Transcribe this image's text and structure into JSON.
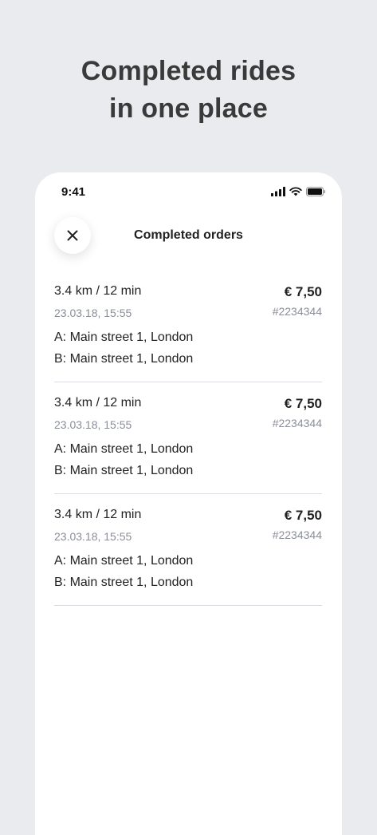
{
  "headline": {
    "line1": "Completed rides",
    "line2": "in one place"
  },
  "status_bar": {
    "time": "9:41",
    "icons": [
      "signal-icon",
      "wifi-icon",
      "battery-icon"
    ]
  },
  "header": {
    "close_icon": "close-icon",
    "title": "Completed orders"
  },
  "orders": [
    {
      "distance_time": "3.4 km / 12 min",
      "price": "€ 7,50",
      "date": "23.03.18, 15:55",
      "id": "#2234344",
      "from": "A: Main street 1, London",
      "to": "B: Main street 1, London"
    },
    {
      "distance_time": "3.4 km / 12 min",
      "price": "€ 7,50",
      "date": "23.03.18, 15:55",
      "id": "#2234344",
      "from": "A: Main street 1, London",
      "to": "B: Main street 1, London"
    },
    {
      "distance_time": "3.4 km / 12 min",
      "price": "€ 7,50",
      "date": "23.03.18, 15:55",
      "id": "#2234344",
      "from": "A: Main street 1, London",
      "to": "B: Main street 1, London"
    }
  ],
  "colors": {
    "background": "#e9ebee",
    "card": "#ffffff",
    "text": "#222222",
    "muted": "#8a8e98",
    "divider": "#dcdde3"
  }
}
